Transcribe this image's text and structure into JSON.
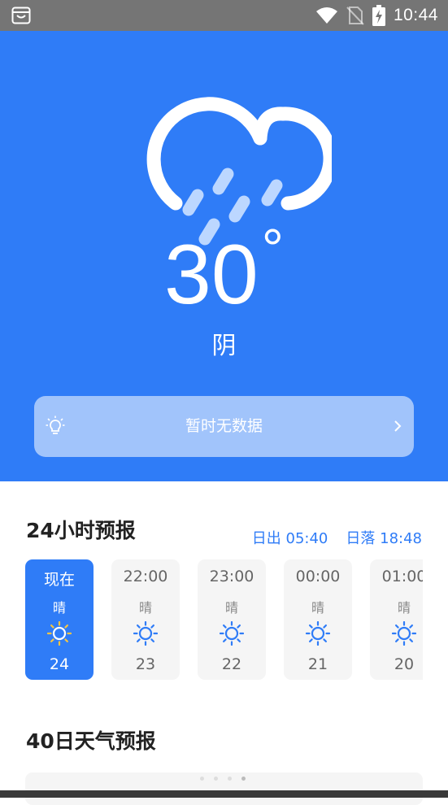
{
  "status_bar": {
    "time": "10:44",
    "icons": [
      "notification-bag-icon",
      "wifi-icon",
      "no-sim-icon",
      "battery-charging-icon"
    ]
  },
  "current": {
    "icon": "cloud-rain-icon",
    "temperature": "30",
    "degree_symbol": "°",
    "condition": "阴"
  },
  "notice": {
    "icon": "lightbulb-icon",
    "text": "暂时无数据",
    "chevron": "chevron-right-icon"
  },
  "hourly": {
    "title": "24小时预报",
    "sunrise": "日出 05:40",
    "sunset": "日落 18:48",
    "items": [
      {
        "time": "现在",
        "condition": "晴",
        "icon": "sun-icon",
        "temp": "24",
        "active": true
      },
      {
        "time": "22:00",
        "condition": "晴",
        "icon": "sun-icon",
        "temp": "23",
        "active": false
      },
      {
        "time": "23:00",
        "condition": "晴",
        "icon": "sun-icon",
        "temp": "22",
        "active": false
      },
      {
        "time": "00:00",
        "condition": "晴",
        "icon": "sun-icon",
        "temp": "21",
        "active": false
      },
      {
        "time": "01:00",
        "condition": "晴",
        "icon": "sun-icon",
        "temp": "20",
        "active": false
      }
    ]
  },
  "daily": {
    "title": "40日天气预报"
  },
  "colors": {
    "accent": "#2f7cf7",
    "status_bar": "#757575",
    "card_bg": "#f5f5f5",
    "sun_active": "#f5c542"
  }
}
